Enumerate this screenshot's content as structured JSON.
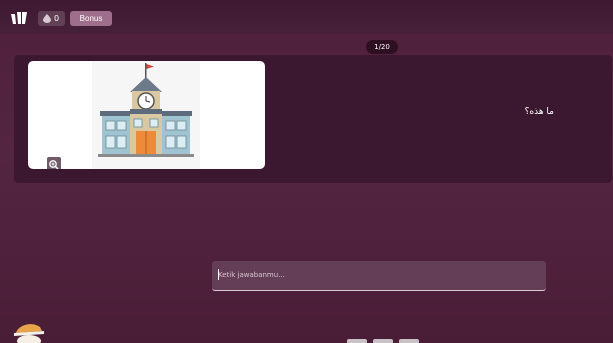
{
  "topbar": {
    "logo_icon": "quizizz-logo-icon",
    "powerups_count": "0",
    "bonus_label": "Bonus"
  },
  "question": {
    "counter": "1/20",
    "text": "ما هذه؟",
    "image_icon": "school-building-icon",
    "zoom_icon": "zoom-in-icon"
  },
  "answer": {
    "placeholder": "Ketik jawabanmu...",
    "value": ""
  },
  "colors": {
    "background": "#4f1f3b",
    "card": "#3b1830",
    "bonus": "#9e6e8c",
    "input": "#643e56"
  }
}
